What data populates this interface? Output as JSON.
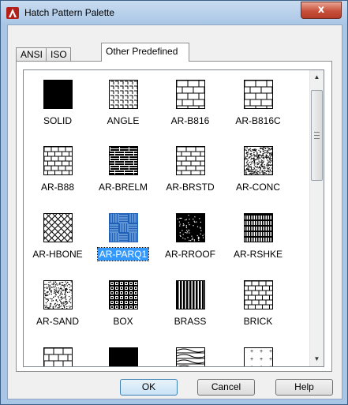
{
  "window": {
    "title": "Hatch Pattern Palette",
    "close_glyph": "x"
  },
  "tabs": [
    {
      "label": "ANSI",
      "active": false
    },
    {
      "label": "ISO",
      "active": false
    },
    {
      "label": "Other Predefined",
      "active": true
    }
  ],
  "patterns": [
    {
      "name": "SOLID",
      "icon": "solid-pattern-icon"
    },
    {
      "name": "ANGLE",
      "icon": "angle-pattern-icon"
    },
    {
      "name": "AR-B816",
      "icon": "brick-large-pattern-icon"
    },
    {
      "name": "AR-B816C",
      "icon": "brick-large-pattern-icon"
    },
    {
      "name": "AR-B88",
      "icon": "brick-pattern-icon"
    },
    {
      "name": "AR-BRELM",
      "icon": "brick-dense-pattern-icon"
    },
    {
      "name": "AR-BRSTD",
      "icon": "brick-standard-pattern-icon"
    },
    {
      "name": "AR-CONC",
      "icon": "concrete-pattern-icon"
    },
    {
      "name": "AR-HBONE",
      "icon": "herringbone-pattern-icon"
    },
    {
      "name": "AR-PARQ1",
      "icon": "parquet-pattern-icon",
      "selected": true
    },
    {
      "name": "AR-RROOF",
      "icon": "roof-pattern-icon"
    },
    {
      "name": "AR-RSHKE",
      "icon": "shake-pattern-icon"
    },
    {
      "name": "AR-SAND",
      "icon": "sand-pattern-icon"
    },
    {
      "name": "BOX",
      "icon": "box-pattern-icon"
    },
    {
      "name": "BRASS",
      "icon": "brass-pattern-icon"
    },
    {
      "name": "BRICK",
      "icon": "brick-pattern-icon"
    },
    {
      "name": "",
      "icon": "brick-partial-pattern-icon"
    },
    {
      "name": "",
      "icon": "solid-partial-pattern-icon"
    },
    {
      "name": "",
      "icon": "wave-partial-pattern-icon"
    },
    {
      "name": "",
      "icon": "dots-partial-pattern-icon"
    }
  ],
  "buttons": {
    "ok": "OK",
    "cancel": "Cancel",
    "help": "Help"
  },
  "colors": {
    "selection": "#3399ff",
    "title_close": "#c7503b"
  }
}
